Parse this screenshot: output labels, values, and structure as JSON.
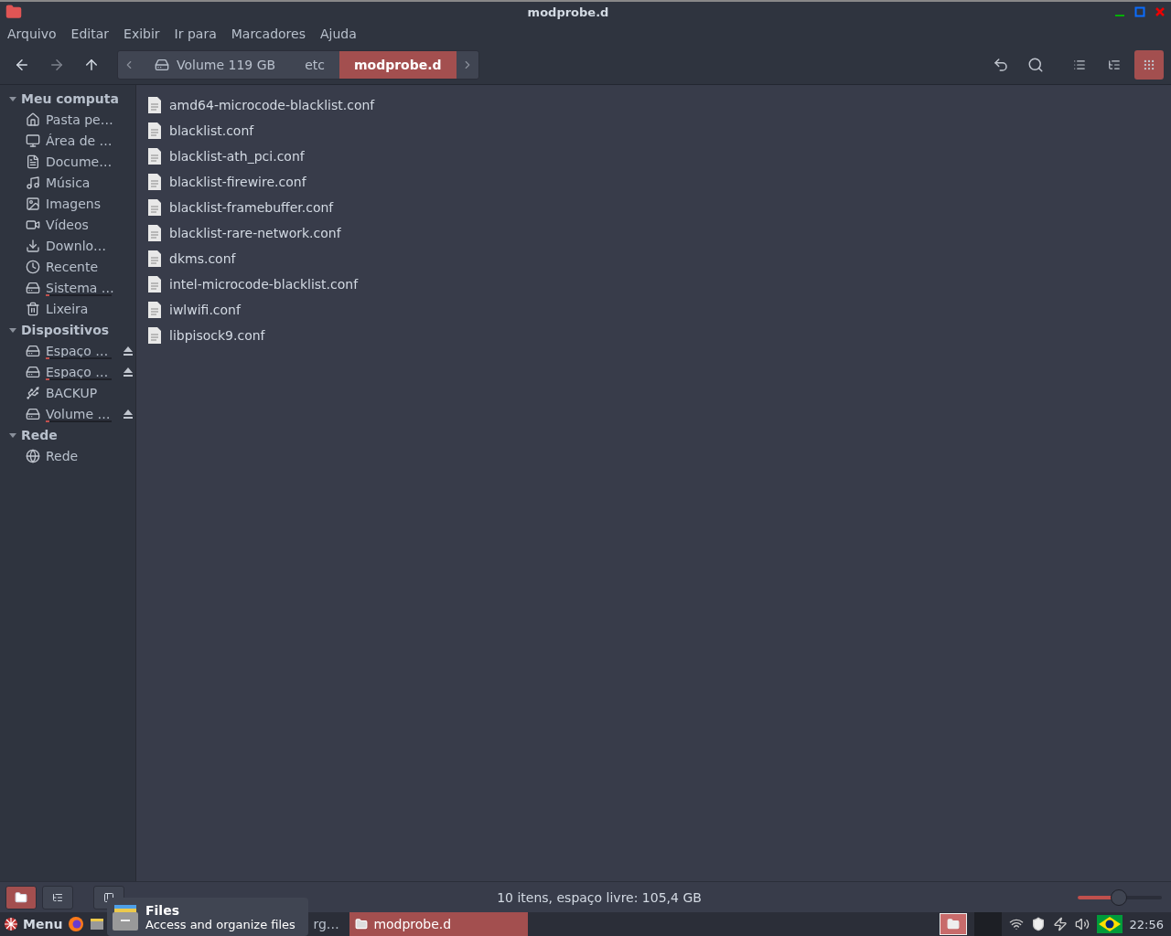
{
  "window": {
    "title": "modprobe.d"
  },
  "menu": [
    "Arquivo",
    "Editar",
    "Exibir",
    "Ir para",
    "Marcadores",
    "Ajuda"
  ],
  "breadcrumb": [
    {
      "label": "Volume 119 GB",
      "selected": false
    },
    {
      "label": "etc",
      "selected": false
    },
    {
      "label": "modprobe.d",
      "selected": true
    }
  ],
  "view_buttons": [
    {
      "selected": false
    },
    {
      "selected": false
    },
    {
      "selected": true
    }
  ],
  "sidebar": [
    {
      "label": "Meu computa",
      "expanded": true,
      "children": [
        {
          "label": "Pasta pe…"
        },
        {
          "label": "Área de …"
        },
        {
          "label": "Docume…"
        },
        {
          "label": "Música"
        },
        {
          "label": "Imagens"
        },
        {
          "label": "Vídeos"
        },
        {
          "label": "Downlo…"
        },
        {
          "label": "Recente"
        },
        {
          "label": "Sistema …",
          "level": 0.05
        },
        {
          "label": "Lixeira"
        }
      ]
    },
    {
      "label": "Dispositivos",
      "expanded": true,
      "children": [
        {
          "label": "Espaço …",
          "level": 0.05,
          "eject": true
        },
        {
          "label": "Espaço …",
          "level": 0.05,
          "eject": true
        },
        {
          "label": "BACKUP",
          "eject": false
        },
        {
          "label": "Volume …",
          "level": 0.05,
          "eject": true
        }
      ]
    },
    {
      "label": "Rede",
      "expanded": true,
      "children": [
        {
          "label": "Rede"
        }
      ]
    }
  ],
  "files": [
    "amd64-microcode-blacklist.conf",
    "blacklist.conf",
    "blacklist-ath_pci.conf",
    "blacklist-firewire.conf",
    "blacklist-framebuffer.conf",
    "blacklist-rare-network.conf",
    "dkms.conf",
    "intel-microcode-blacklist.conf",
    "iwlwifi.conf",
    "libpisock9.conf"
  ],
  "status_bar": {
    "text": "10 itens, espaço livre: 105,4 GB",
    "zoom": {
      "level": 0.5
    },
    "panel_buttons": [
      {
        "selected": true
      },
      {
        "selected": false
      }
    ]
  },
  "taskbar": {
    "menu_label": "Menu",
    "hidden_window_label": "rg…",
    "windows": [
      {
        "label": "modprobe.d",
        "selected": true
      }
    ],
    "clock": "22:56"
  },
  "tooltip": {
    "title": "Files",
    "description": "Access and organize files"
  }
}
